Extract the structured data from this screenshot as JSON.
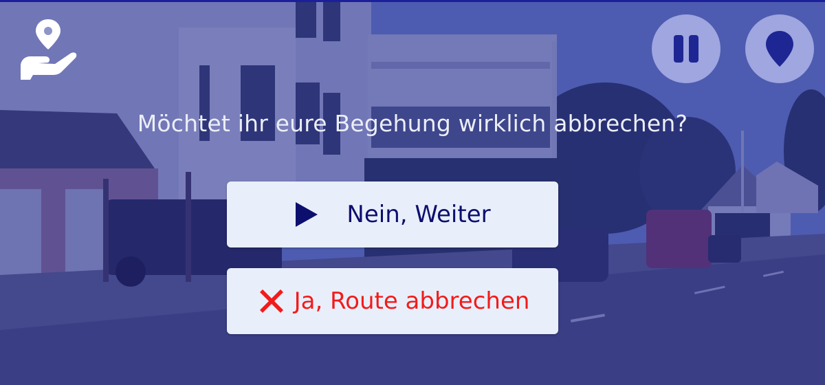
{
  "dialog": {
    "question": "Möchtet ihr eure Begehung wirklich abbrechen?",
    "continue_label": "Nein, Weiter",
    "abort_label": "Ja, Route abbrechen"
  },
  "icons": {
    "logo": "hand-with-location-pin-icon",
    "pause": "pause-icon",
    "location": "location-pin-icon",
    "continue": "play-icon",
    "abort": "cross-mark-icon"
  },
  "colors": {
    "overlay": "#24288c",
    "round_button_bg": "#9fa6e0",
    "icon_blue": "#1e2694",
    "button_bg": "#e9effa",
    "continue_text": "#0d0f6e",
    "abort_text": "#f21b1b"
  }
}
